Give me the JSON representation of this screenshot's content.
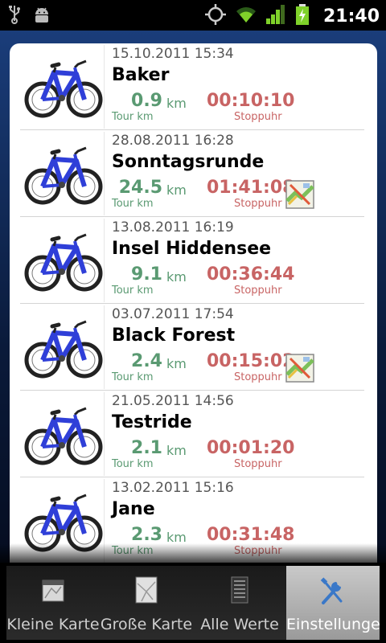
{
  "status_bar": {
    "time": "21:40",
    "icons": [
      "usb-icon",
      "android-debug-icon",
      "gps-icon",
      "wifi-icon",
      "signal-icon",
      "battery-charging-icon"
    ]
  },
  "colors": {
    "distance": "#5a9a72",
    "duration": "#c86464",
    "background": "#0a1a3a"
  },
  "tours": [
    {
      "date": "15.10.2011 15:34",
      "name": "Baker",
      "distance": "0.9",
      "distance_unit": "km",
      "distance_label": "Tour km",
      "duration": "00:10:10",
      "duration_label": "Stoppuhr",
      "has_map": false
    },
    {
      "date": "28.08.2011 16:28",
      "name": "Sonntagsrunde",
      "distance": "24.5",
      "distance_unit": "km",
      "distance_label": "Tour km",
      "duration": "01:41:08",
      "duration_label": "Stoppuhr",
      "has_map": true
    },
    {
      "date": "13.08.2011 16:19",
      "name": "Insel Hiddensee",
      "distance": "9.1",
      "distance_unit": "km",
      "distance_label": "Tour km",
      "duration": "00:36:44",
      "duration_label": "Stoppuhr",
      "has_map": false
    },
    {
      "date": "03.07.2011 17:54",
      "name": "Black Forest",
      "distance": "2.4",
      "distance_unit": "km",
      "distance_label": "Tour km",
      "duration": "00:15:02",
      "duration_label": "Stoppuhr",
      "has_map": true
    },
    {
      "date": "21.05.2011 14:56",
      "name": "Testride",
      "distance": "2.1",
      "distance_unit": "km",
      "distance_label": "Tour km",
      "duration": "00:01:20",
      "duration_label": "Stoppuhr",
      "has_map": false
    },
    {
      "date": "13.02.2011 15:16",
      "name": "Jane",
      "distance": "2.3",
      "distance_unit": "km",
      "distance_label": "Tour km",
      "duration": "00:31:48",
      "duration_label": "Stoppuhr",
      "has_map": false
    }
  ],
  "tabs": [
    {
      "label": "Kleine Karte",
      "icon": "small-map-icon",
      "active": false
    },
    {
      "label": "Große Karte",
      "icon": "large-map-icon",
      "active": false
    },
    {
      "label": "Alle Werte",
      "icon": "all-values-icon",
      "active": false
    },
    {
      "label": "Einstellungen",
      "icon": "settings-tools-icon",
      "active": true
    }
  ]
}
